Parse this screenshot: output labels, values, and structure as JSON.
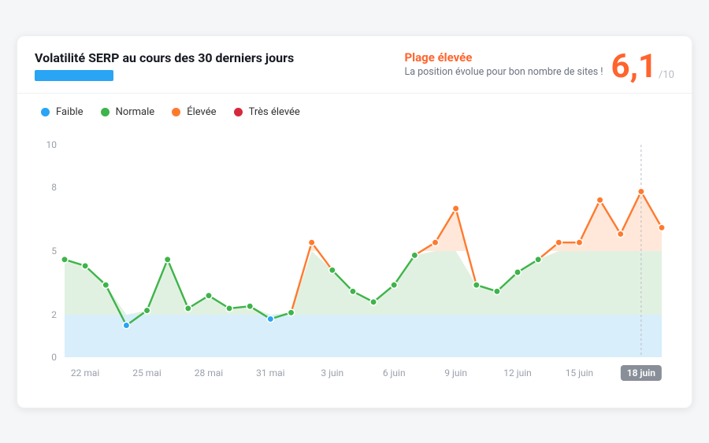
{
  "header": {
    "title": "Volatilité SERP au cours des 30 derniers jours",
    "status_title": "Plage élevée",
    "status_sub": "La position évolue pour bon nombre de sites !",
    "score": "6,1",
    "outof": "/10"
  },
  "legend": {
    "low": "Faible",
    "normal": "Normale",
    "high": "Élevée",
    "vhigh": "Très élevée"
  },
  "colors": {
    "low": "#2aa4f4",
    "normal": "#3eb44a",
    "high": "#ff7a2e",
    "vhigh": "#d6293e"
  },
  "chart_data": {
    "type": "line",
    "ylabel": "",
    "xlabel": "",
    "ylim": [
      0,
      10
    ],
    "yticks": [
      0,
      2,
      5,
      8,
      10
    ],
    "thresholds": {
      "low_max": 2,
      "normal_max": 5,
      "high_max": 8
    },
    "points": [
      {
        "date": "21 mai",
        "value": 4.6,
        "level": "normal"
      },
      {
        "date": "22 mai",
        "value": 4.3,
        "level": "normal"
      },
      {
        "date": "23 mai",
        "value": 3.4,
        "level": "normal"
      },
      {
        "date": "24 mai",
        "value": 1.5,
        "level": "low"
      },
      {
        "date": "25 mai",
        "value": 2.2,
        "level": "normal"
      },
      {
        "date": "26 mai",
        "value": 4.6,
        "level": "normal"
      },
      {
        "date": "27 mai",
        "value": 2.3,
        "level": "normal"
      },
      {
        "date": "28 mai",
        "value": 2.9,
        "level": "normal"
      },
      {
        "date": "29 mai",
        "value": 2.3,
        "level": "normal"
      },
      {
        "date": "30 mai",
        "value": 2.4,
        "level": "normal"
      },
      {
        "date": "31 mai",
        "value": 1.8,
        "level": "low"
      },
      {
        "date": "1 juin",
        "value": 2.1,
        "level": "normal"
      },
      {
        "date": "2 juin",
        "value": 5.4,
        "level": "high"
      },
      {
        "date": "3 juin",
        "value": 4.1,
        "level": "normal"
      },
      {
        "date": "4 juin",
        "value": 3.1,
        "level": "normal"
      },
      {
        "date": "5 juin",
        "value": 2.6,
        "level": "normal"
      },
      {
        "date": "6 juin",
        "value": 3.4,
        "level": "normal"
      },
      {
        "date": "7 juin",
        "value": 4.8,
        "level": "normal"
      },
      {
        "date": "8 juin",
        "value": 5.4,
        "level": "high"
      },
      {
        "date": "9 juin",
        "value": 7.0,
        "level": "high"
      },
      {
        "date": "10 juin",
        "value": 3.4,
        "level": "normal"
      },
      {
        "date": "11 juin",
        "value": 3.1,
        "level": "normal"
      },
      {
        "date": "12 juin",
        "value": 4.0,
        "level": "normal"
      },
      {
        "date": "13 juin",
        "value": 4.6,
        "level": "normal"
      },
      {
        "date": "14 juin",
        "value": 5.4,
        "level": "high"
      },
      {
        "date": "15 juin",
        "value": 5.4,
        "level": "high"
      },
      {
        "date": "16 juin",
        "value": 7.4,
        "level": "high"
      },
      {
        "date": "17 juin",
        "value": 5.8,
        "level": "high"
      },
      {
        "date": "18 juin",
        "value": 7.8,
        "level": "high"
      },
      {
        "date": "19 juin",
        "value": 6.1,
        "level": "high"
      }
    ],
    "xticks": [
      "22 mai",
      "25 mai",
      "28 mai",
      "31 mai",
      "3 juin",
      "6 juin",
      "9 juin",
      "12 juin",
      "15 juin",
      "18 juin"
    ],
    "today_label": "18 juin"
  }
}
